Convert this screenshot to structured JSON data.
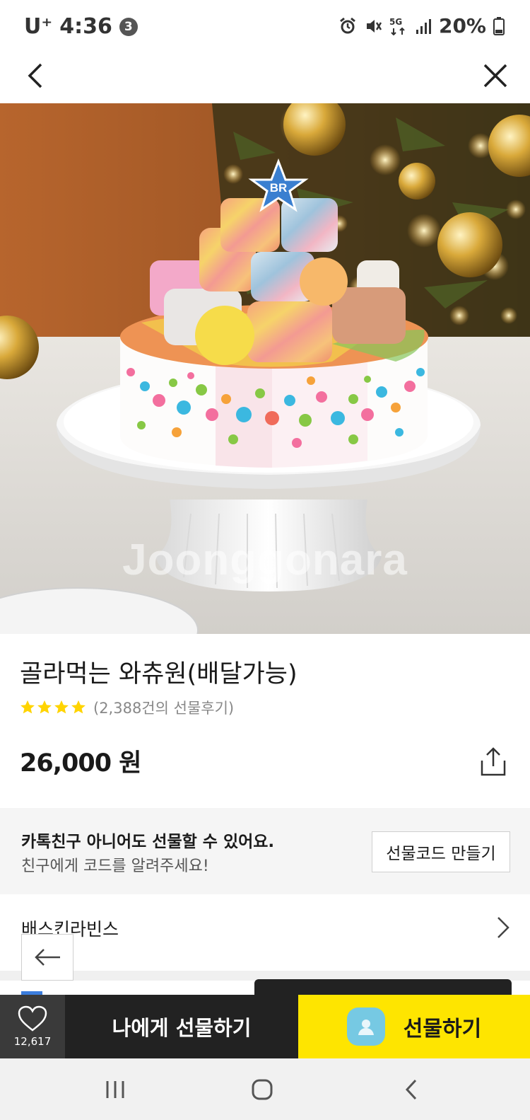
{
  "status_bar": {
    "carrier": "U⁺",
    "time": "4:36",
    "notification_count": "3",
    "battery": "20%",
    "network": "5G"
  },
  "product": {
    "image_watermark": "Joonggonara",
    "title": "골라먹는 와츄원(배달가능)",
    "rating_stars": 4,
    "review_text": "(2,388건의 선물후기)",
    "price": "26,000 원"
  },
  "gift_banner": {
    "headline": "카톡친구 아니어도 선물할 수 있어요.",
    "subtext": "친구에게 코드를 알려주세요!",
    "button_label": "선물코드 만들기"
  },
  "brand": {
    "name": "배스킨라빈스"
  },
  "action_bar": {
    "like_count": "12,617",
    "gift_self_label": "나에게 선물하기",
    "gift_label": "선물하기"
  },
  "colors": {
    "accent_yellow": "#fee500",
    "star_yellow": "#ffd400",
    "dark_button": "#222222"
  }
}
